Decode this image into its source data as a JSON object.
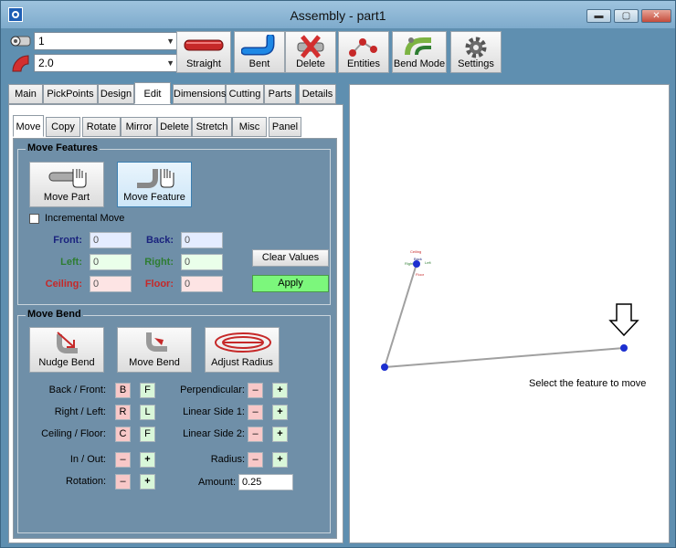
{
  "window": {
    "title": "Assembly - part1",
    "minimize": "▬",
    "maximize": "▢",
    "close": "✕"
  },
  "toolbar": {
    "combo1_value": "1",
    "combo2_value": "2.0",
    "buttons": {
      "straight": "Straight",
      "bent": "Bent",
      "delete": "Delete",
      "entities": "Entities",
      "bend_mode": "Bend Mode",
      "settings": "Settings"
    }
  },
  "tabs_main": [
    "Main",
    "PickPoints",
    "Design",
    "Edit",
    "Dimensions",
    "Cutting",
    "Parts",
    "Details"
  ],
  "tabs_edit": [
    "Move",
    "Copy",
    "Rotate",
    "Mirror",
    "Delete",
    "Stretch",
    "Misc",
    "Panel"
  ],
  "move_features": {
    "title": "Move Features",
    "move_part": "Move Part",
    "move_feature": "Move Feature",
    "incremental_move": "Incremental Move",
    "front_label": "Front:",
    "front_value": "0",
    "back_label": "Back:",
    "back_value": "0",
    "left_label": "Left:",
    "left_value": "0",
    "right_label": "Right:",
    "right_value": "0",
    "ceiling_label": "Ceiling:",
    "ceiling_value": "0",
    "floor_label": "Floor:",
    "floor_value": "0",
    "clear_values": "Clear Values",
    "apply": "Apply"
  },
  "move_bend": {
    "title": "Move Bend",
    "nudge_bend": "Nudge Bend",
    "move_bend": "Move Bend",
    "adjust_radius": "Adjust Radius",
    "back_front_label": "Back / Front:",
    "back_btn": "B",
    "front_btn": "F",
    "right_left_label": "Right / Left:",
    "right_btn": "R",
    "left_btn": "L",
    "ceiling_floor_label": "Ceiling / Floor:",
    "ceiling_btn": "C",
    "floor_btn": "F",
    "in_out_label": "In / Out:",
    "rotation_label": "Rotation:",
    "perpendicular_label": "Perpendicular:",
    "linear_side1_label": "Linear Side 1:",
    "linear_side2_label": "Linear Side 2:",
    "radius_label": "Radius:",
    "amount_label": "Amount:",
    "amount_value": "0.25",
    "minus": "–",
    "plus": "+"
  },
  "canvas": {
    "hint": "Select the feature to move",
    "axis_ceiling": "Ceiling",
    "axis_back": "Back",
    "axis_left": "Left",
    "axis_floor": "Floor",
    "axis_right": "Right"
  },
  "colors": {
    "front": "#1a237e",
    "back": "#1a237e",
    "left": "#2e7d32",
    "right": "#2e7d32",
    "ceiling": "#c62828",
    "floor": "#c62828",
    "apply_bg": "#7cf77c",
    "point": "#1c2fd0"
  }
}
